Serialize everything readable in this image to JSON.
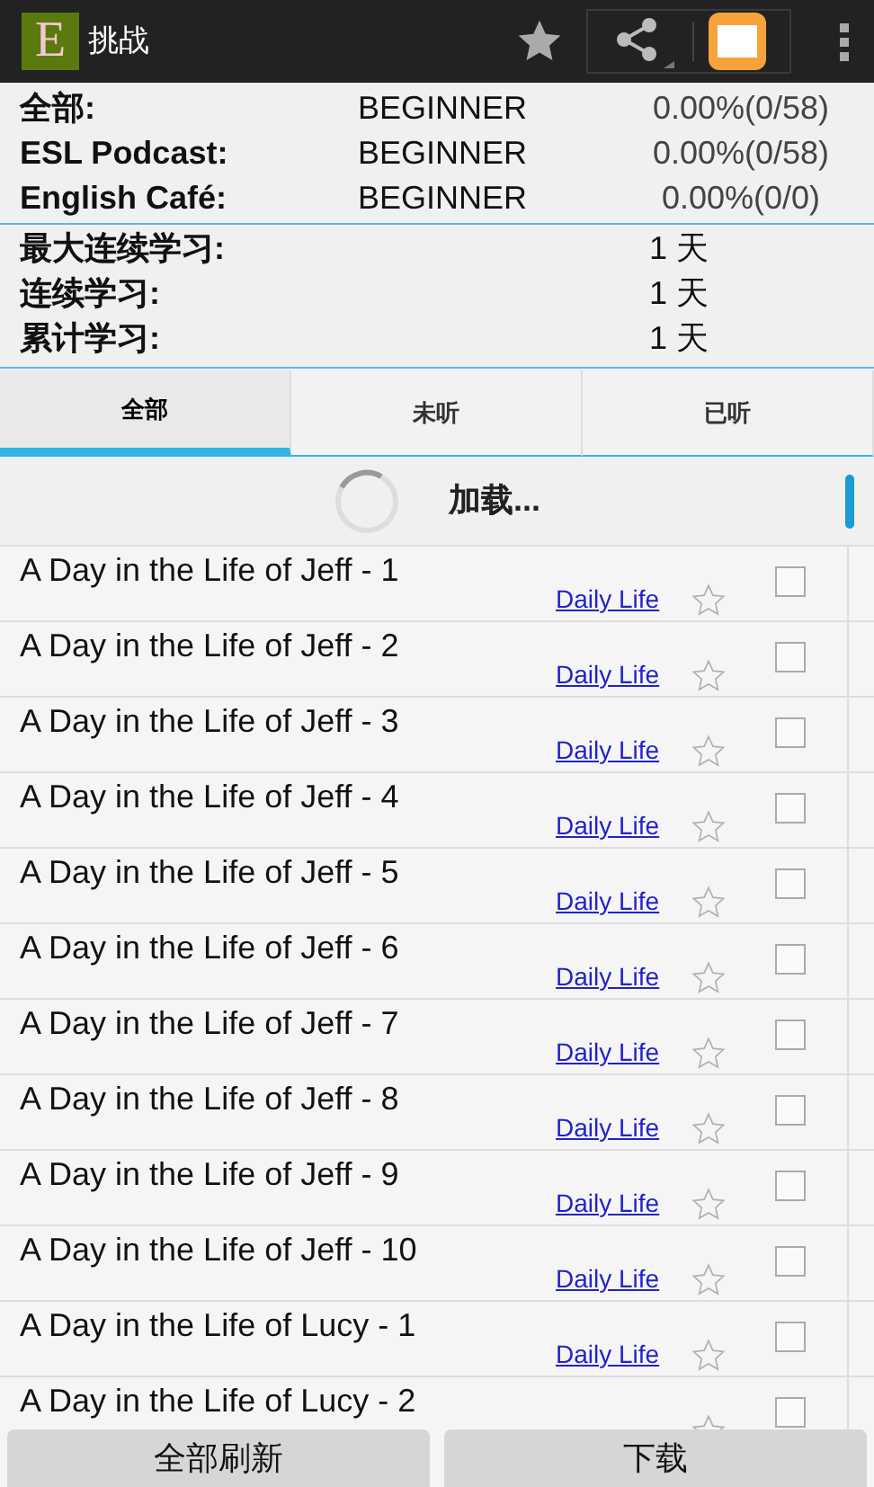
{
  "app_bar": {
    "logo": "E",
    "title": "挑战"
  },
  "stats": [
    {
      "label": "全部:",
      "level_text": "BEGINNER",
      "progress": "0.00%(0/58)"
    },
    {
      "label": "ESL Podcast:",
      "level_text": "BEGINNER",
      "progress": "0.00%(0/58)"
    },
    {
      "label": "English Café:",
      "level_text": "BEGINNER",
      "progress": "0.00%(0/0)"
    }
  ],
  "streaks": [
    {
      "label": "最大连续学习:",
      "value": "1 天"
    },
    {
      "label": "连续学习:",
      "value": "1 天"
    },
    {
      "label": "累计学习:",
      "value": "1 天"
    }
  ],
  "tabs": [
    {
      "label": "全部",
      "selected": true
    },
    {
      "label": "未听",
      "selected": false
    },
    {
      "label": "已听",
      "selected": false
    }
  ],
  "loading": {
    "text": "加载..."
  },
  "episodes": [
    {
      "title": "A Day in the Life of Jeff - 1",
      "category": "Daily Life",
      "starred": false,
      "checked": false
    },
    {
      "title": "A Day in the Life of Jeff - 2",
      "category": "Daily Life",
      "starred": false,
      "checked": false
    },
    {
      "title": "A Day in the Life of Jeff - 3",
      "category": "Daily Life",
      "starred": false,
      "checked": false
    },
    {
      "title": "A Day in the Life of Jeff - 4",
      "category": "Daily Life",
      "starred": false,
      "checked": false
    },
    {
      "title": "A Day in the Life of Jeff - 5",
      "category": "Daily Life",
      "starred": false,
      "checked": false
    },
    {
      "title": "A Day in the Life of Jeff - 6",
      "category": "Daily Life",
      "starred": false,
      "checked": false
    },
    {
      "title": "A Day in the Life of Jeff - 7",
      "category": "Daily Life",
      "starred": false,
      "checked": false
    },
    {
      "title": "A Day in the Life of Jeff - 8",
      "category": "Daily Life",
      "starred": false,
      "checked": false
    },
    {
      "title": "A Day in the Life of Jeff - 9",
      "category": "Daily Life",
      "starred": false,
      "checked": false
    },
    {
      "title": "A Day in the Life of Jeff - 10",
      "category": "Daily Life",
      "starred": false,
      "checked": false
    },
    {
      "title": "A Day in the Life of Lucy - 1",
      "category": "Daily Life",
      "starred": false,
      "checked": false
    },
    {
      "title": "A Day in the Life of Lucy - 2",
      "starred": false,
      "checked": false
    }
  ],
  "buttons": [
    "全部刷新",
    "下载"
  ]
}
